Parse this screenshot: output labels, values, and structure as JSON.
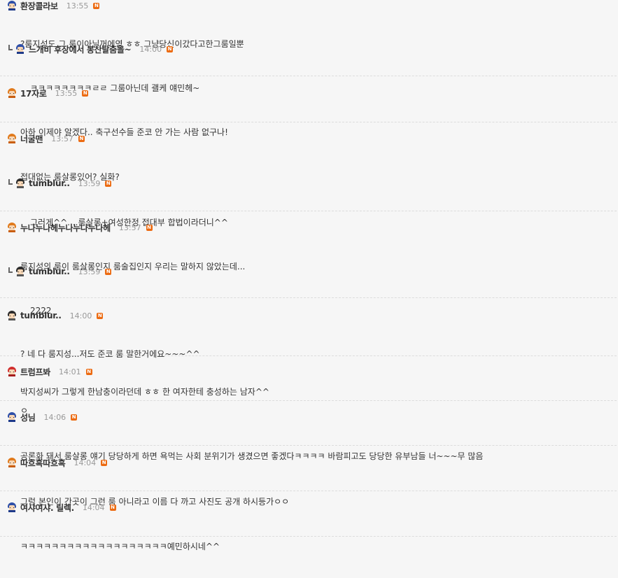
{
  "comments": [
    {
      "nick": "환장콜라보",
      "time": "13:55",
      "badge": "N",
      "lines": [
        "?룸지성도 그 룸이아닐꺼에영 ㅎㅎ 그냥당신이갔다고한그룸일뿐",
        ""
      ]
    },
    {
      "nick": "느개비 후장에서 봉산탈춤을~",
      "time": "14:00",
      "badge": "N",
      "lines": [
        "ㅋㅋㅋㅋㅋㅋㅋㅋㄹㄹ 그룸아닌데 괠케 얘민헤~",
        ""
      ]
    },
    {
      "nick": "17자로",
      "time": "13:55",
      "badge": "N",
      "lines": [
        "아하 이제야 알겠다.. 축구선수들 준코 안 가는 사람 없구나!",
        ""
      ]
    },
    {
      "nick": "너굴맨",
      "time": "13:57",
      "badge": "N",
      "lines": [
        "접대없는 룸살롱있어? 실화?",
        ""
      ]
    },
    {
      "nick": "tumblur..",
      "time": "13:59",
      "badge": "N",
      "lines": [
        "그러게^^....룸살롱+여성한정 접대부 합법이라더니^^",
        ""
      ]
    },
    {
      "nick": "누나누나헤누나누나누나헤",
      "time": "13:57",
      "badge": "N",
      "lines": [
        "룸지성의 룸이 룸살롱인지 룸술집인지 우리는 말하지 않았는데...",
        ""
      ]
    },
    {
      "nick": "tumblur..",
      "time": "13:59",
      "badge": "N",
      "lines": [
        "2222",
        ""
      ]
    },
    {
      "nick": "tumblur..",
      "time": "14:00",
      "badge": "N",
      "lines": [
        "? 네 다 룸지성...저도 준코 룸 말한거에요~~~^^",
        "박지성씨가 그렇게 한남충이라던데 ㅎㅎ 한 여자한테 충성하는 남자^^"
      ]
    },
    {
      "nick": "트럼프봐",
      "time": "14:01",
      "badge": "N",
      "lines": [
        "ㅇ",
        ""
      ]
    },
    {
      "nick": "성님",
      "time": "14:06",
      "badge": "N",
      "lines": [
        "공론화 돼서 룸살롱 얘기 당당하게 하면 욕먹는 사회 분위기가 생겼으면 좋겠다ㅋㅋㅋㅋ 바람피고도 당당한 유부남들 너~~~무 많음",
        ""
      ]
    },
    {
      "nick": "따흐흑따흐흑",
      "time": "14:04",
      "badge": "N",
      "lines": [
        "그럼 본인이 간곳이 그런 룸 아니라고 이름 다 까고 사진도 공개 하시등가ㅇㅇ",
        ""
      ]
    },
    {
      "nick": "여샤여샤. 릴렉.",
      "time": "14:04",
      "badge": "N",
      "lines": [
        "ㅋㅋㅋㅋㅋㅋㅋㅋㅋㅋㅋㅋㅋㅋㅋㅋㅋㅋㅋ예민하시네^^",
        ""
      ]
    }
  ]
}
